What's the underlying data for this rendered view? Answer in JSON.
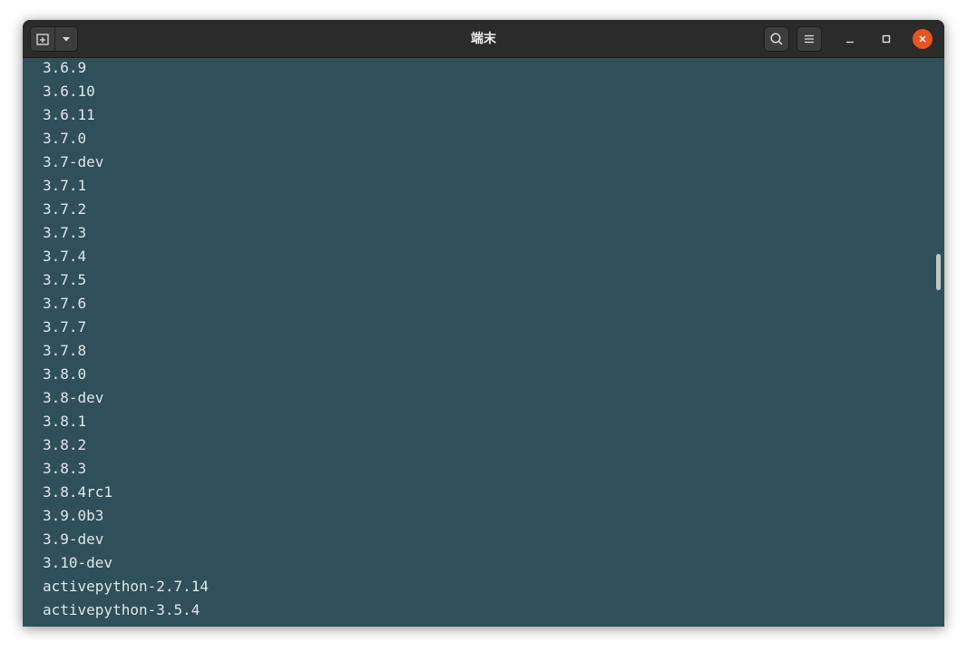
{
  "window": {
    "title": "端末"
  },
  "terminal": {
    "lines": [
      "3.6.9",
      "3.6.10",
      "3.6.11",
      "3.7.0",
      "3.7-dev",
      "3.7.1",
      "3.7.2",
      "3.7.3",
      "3.7.4",
      "3.7.5",
      "3.7.6",
      "3.7.7",
      "3.7.8",
      "3.8.0",
      "3.8-dev",
      "3.8.1",
      "3.8.2",
      "3.8.3",
      "3.8.4rc1",
      "3.9.0b3",
      "3.9-dev",
      "3.10-dev",
      "activepython-2.7.14",
      "activepython-3.5.4"
    ]
  },
  "icons": {
    "new_tab": "new-tab-icon",
    "tab_menu": "chevron-down-icon",
    "search": "search-icon",
    "menu": "hamburger-menu-icon",
    "minimize": "minimize-icon",
    "maximize": "maximize-icon",
    "close": "close-icon"
  },
  "colors": {
    "terminal_background": "#2f4f5a",
    "terminal_text": "#dfe6e8",
    "titlebar": "#2b2b2b",
    "close_button": "#e9541f"
  }
}
